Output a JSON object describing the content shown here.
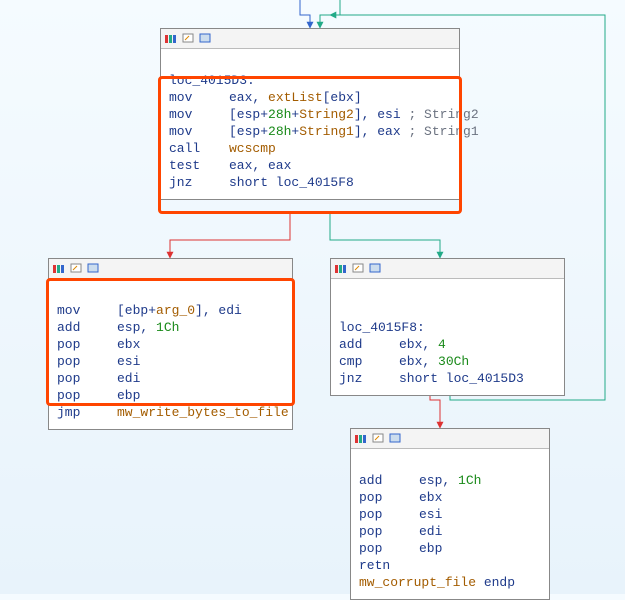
{
  "node1": {
    "label": "loc_4015D3:",
    "l1_op": "mov",
    "l1_r": "eax, ",
    "l1_id": "extList",
    "l1_br": "[ebx]",
    "l2_op": "mov",
    "l2_a": "[esp+",
    "l2_n": "28h",
    "l2_b": "+",
    "l2_id": "String2",
    "l2_c": "], esi ",
    "l2_cm": "; String2",
    "l3_op": "mov",
    "l3_a": "[esp+",
    "l3_n": "28h",
    "l3_b": "+",
    "l3_id": "String1",
    "l3_c": "], eax ",
    "l3_cm": "; String1",
    "l4_op": "call",
    "l4_id": "wcscmp",
    "l5_op": "test",
    "l5_r": "eax, eax",
    "l6_op": "jnz",
    "l6_r": "short loc_4015F8"
  },
  "node2": {
    "l1_op": "mov",
    "l1_a": "[ebp+",
    "l1_id": "arg_0",
    "l1_b": "], edi",
    "l2_op": "add",
    "l2_a": "esp, ",
    "l2_n": "1Ch",
    "l3_op": "pop",
    "l3_r": "ebx",
    "l4_op": "pop",
    "l4_r": "esi",
    "l5_op": "pop",
    "l5_r": "edi",
    "l6_op": "pop",
    "l6_r": "ebp",
    "l7_op": "jmp",
    "l7_id": "mw_write_bytes_to_file"
  },
  "node3": {
    "label": "loc_4015F8:",
    "l1_op": "add",
    "l1_a": "ebx, ",
    "l1_n": "4",
    "l2_op": "cmp",
    "l2_a": "ebx, ",
    "l2_n": "30Ch",
    "l3_op": "jnz",
    "l3_r": "short loc_4015D3"
  },
  "node4": {
    "l1_op": "add",
    "l1_a": "esp, ",
    "l1_n": "1Ch",
    "l2_op": "pop",
    "l2_r": "ebx",
    "l3_op": "pop",
    "l3_r": "esi",
    "l4_op": "pop",
    "l4_r": "edi",
    "l5_op": "pop",
    "l5_r": "ebp",
    "l6_op": "retn",
    "l6_r": "",
    "l7_id": "mw_corrupt_file",
    "l7_r": " endp"
  }
}
